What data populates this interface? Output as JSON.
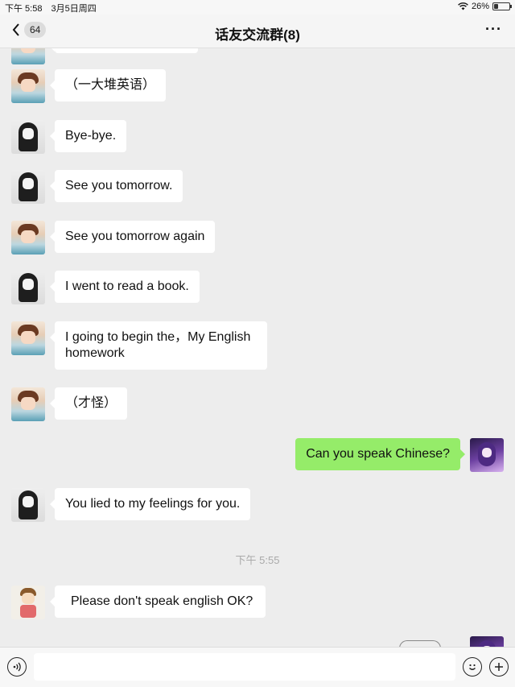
{
  "status_bar": {
    "time": "下午 5:58",
    "date": "3月5日周四",
    "battery_text": "26%",
    "battery_level": 0.26
  },
  "nav": {
    "back_count": "64",
    "title": "话友交流群(8)",
    "more_icon": "ellipsis-icon"
  },
  "messages": [
    {
      "side": "left",
      "avatar": "boy",
      "text": "（一大堆英语）"
    },
    {
      "side": "left",
      "avatar": "girl",
      "text": "Bye-bye."
    },
    {
      "side": "left",
      "avatar": "girl",
      "text": "See you tomorrow."
    },
    {
      "side": "left",
      "avatar": "boy",
      "text": "See you tomorrow again"
    },
    {
      "side": "left",
      "avatar": "girl",
      "text": "I went to read a book."
    },
    {
      "side": "left",
      "avatar": "boy",
      "text": "I going to begin the，My English homework"
    },
    {
      "side": "left",
      "avatar": "boy",
      "text": "（才怪）"
    },
    {
      "side": "right",
      "avatar": "anime",
      "text": "Can you speak Chinese?"
    },
    {
      "side": "left",
      "avatar": "girl",
      "text": "You lied to my feelings for you."
    },
    {
      "type": "timestamp",
      "text": "下午 5:55"
    },
    {
      "side": "left",
      "avatar": "cartoon",
      "text": "Please don't speak english OK?"
    }
  ],
  "input_bar": {
    "voice_icon": "voice-icon",
    "placeholder": "",
    "emoji_icon": "emoji-icon",
    "plus_icon": "plus-icon"
  },
  "colors": {
    "own_bubble": "#95ec69",
    "other_bubble": "#ffffff",
    "background": "#ededed"
  }
}
